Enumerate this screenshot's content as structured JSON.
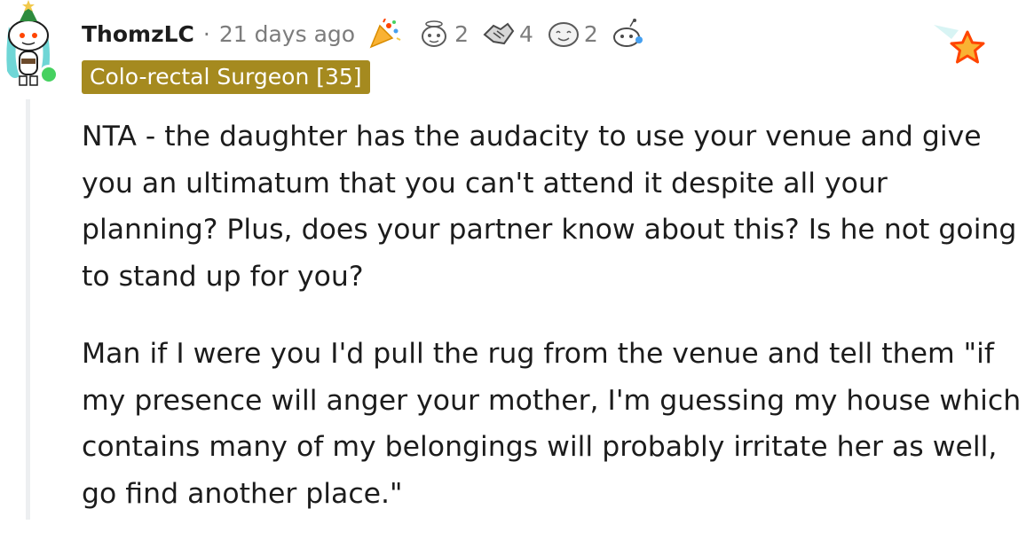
{
  "comment": {
    "username": "ThomzLC",
    "separator": "·",
    "timestamp": "21 days ago",
    "flair": "Colo-rectal Surgeon [35]",
    "awards": [
      {
        "icon": "party-popper-award-icon",
        "count": ""
      },
      {
        "icon": "wholesome-award-icon",
        "count": "2"
      },
      {
        "icon": "handshake-award-icon",
        "count": "4"
      },
      {
        "icon": "face-award-icon",
        "count": "2"
      },
      {
        "icon": "snoo-award-icon",
        "count": ""
      }
    ],
    "paragraphs": [
      "NTA - the daughter has the audacity to use your venue and give you an ultimatum that you can't attend it despite all your planning? Plus, does your partner know about this? Is he not going to stand up for you?",
      "Man if I were you I'd pull the rug from the venue and tell them \"if my presence will anger your mother, I'm guessing my house which contains many of my belongings will probably irritate her as well, go find another place.\""
    ]
  },
  "colors": {
    "flair_background": "#a58a1f",
    "online": "#46d160",
    "star": "#f9b233",
    "star_outline": "#ff4500",
    "meta_text": "#7c7c7c"
  }
}
